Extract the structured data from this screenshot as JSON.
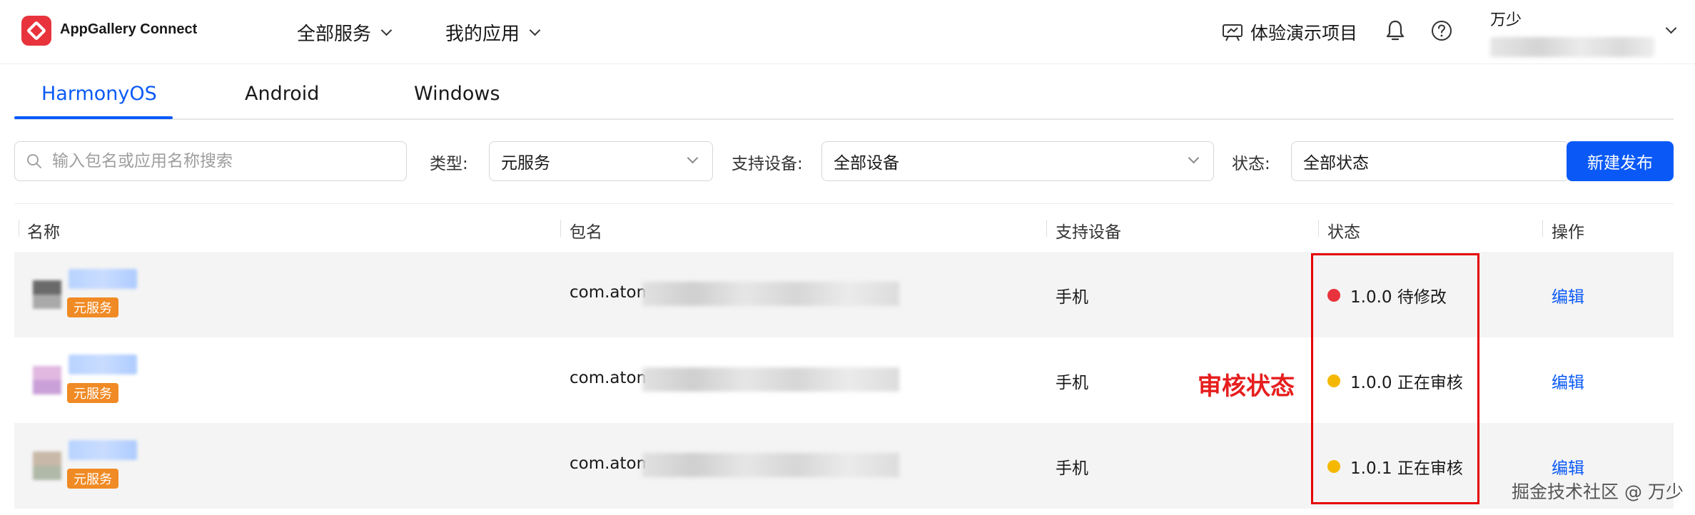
{
  "header": {
    "brand": "AppGallery Connect",
    "nav": [
      {
        "label": "全部服务"
      },
      {
        "label": "我的应用"
      }
    ],
    "demo_label": "体验演示项目",
    "user_name": "万少"
  },
  "tabs": [
    {
      "label": "HarmonyOS",
      "active": true
    },
    {
      "label": "Android",
      "active": false
    },
    {
      "label": "Windows",
      "active": false
    }
  ],
  "filters": {
    "search_placeholder": "输入包名或应用名称搜索",
    "type_label": "类型:",
    "type_value": "元服务",
    "device_label": "支持设备:",
    "device_value": "全部设备",
    "status_label": "状态:",
    "status_value": "全部状态",
    "new_button": "新建发布"
  },
  "table": {
    "columns": [
      "名称",
      "包名",
      "支持设备",
      "状态",
      "操作"
    ],
    "rows": [
      {
        "tag": "元服务",
        "package_prefix": "com.atom",
        "device": "手机",
        "status": "1.0.0 待修改",
        "status_color": "#e8333c",
        "action": "编辑"
      },
      {
        "tag": "元服务",
        "package_prefix": "com.atom",
        "device": "手机",
        "status": "1.0.0 正在审核",
        "status_color": "#f5b800",
        "action": "编辑"
      },
      {
        "tag": "元服务",
        "package_prefix": "com.atom",
        "device": "手机",
        "status": "1.0.1 正在审核",
        "status_color": "#f5b800",
        "action": "编辑"
      }
    ]
  },
  "annotation": {
    "label": "审核状态",
    "color": "#e61e1e"
  },
  "watermark": "掘金技术社区 @ 万少",
  "colors": {
    "accent": "#0a59f7",
    "tag": "#f08a24"
  }
}
